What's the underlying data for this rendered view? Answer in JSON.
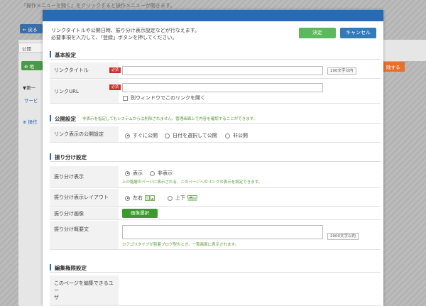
{
  "background": {
    "hint": "『操作メニューを開く』をクリックすると操作メニューが開きます。",
    "back_button": "← 戻る",
    "tab": "公開",
    "green_button": "⊕ 地",
    "tree_item": "▼第一",
    "link_item": "サービ",
    "operation_item": "⊕ 操作",
    "orange_button": "除する"
  },
  "modal": {
    "intro_line1": "リンクタイトルや公開日時、振り分け表示設定などが行なえます。",
    "intro_line2": "必要事項を入力して、「登録」ボタンを押してください。",
    "ok_button": "決定",
    "cancel_button": "キャンセル"
  },
  "basic": {
    "title": "基本設定",
    "link_title_label": "リンクタイトル",
    "required_badge": "必須",
    "link_title_limit": "100文字以内",
    "link_url_label": "リンクURL",
    "new_window_label": "別ウィンドウでこのリンクを開く"
  },
  "publish": {
    "title": "公開設定",
    "note": "非表示を指定してもシステムからは削除されません。管理画面上で内容を確認することができます。",
    "visibility_label": "リンク表示の公開設定",
    "options": [
      "すぐに公開",
      "日付を選択して公開",
      "非公開"
    ]
  },
  "distribution": {
    "title": "振り分け設定",
    "display_label": "振り分け表示",
    "display_options": [
      "表示",
      "非表示"
    ],
    "display_note": "上の階層のページに表示される、このページへのリンクの表示を設定できます。",
    "layout_label": "振り分け表示レイアウト",
    "layout_options": [
      "左右",
      "上下"
    ],
    "image_label": "振り分け画像",
    "image_button": "画像選択",
    "summary_label": "振り分け概要文",
    "summary_limit": "2000文字以内",
    "summary_note": "カテゴリタイプが新着ブログ型のとき、一覧画面に表示されます。"
  },
  "permissions": {
    "title": "編集権限設定",
    "users_label_line1": "このページを編集できるユー",
    "users_label_line2": "ザ"
  },
  "colors": {
    "header": "#2a6ab0",
    "ok": "#5cb85c",
    "cancel": "#337ab7",
    "required": "#c9302c",
    "note": "#5a9a3a"
  }
}
